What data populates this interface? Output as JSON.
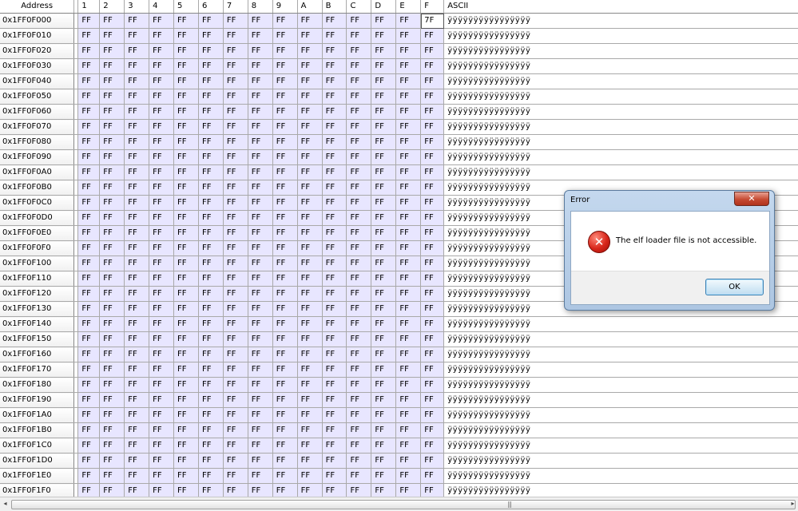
{
  "table": {
    "columns": {
      "address": "Address",
      "hex": [
        "1",
        "2",
        "3",
        "4",
        "5",
        "6",
        "7",
        "8",
        "9",
        "A",
        "B",
        "C",
        "D",
        "E",
        "F"
      ],
      "ascii": "ASCII"
    },
    "rows": [
      {
        "address": "0x1FF0F000",
        "cells": [
          "FF",
          "FF",
          "FF",
          "FF",
          "FF",
          "FF",
          "FF",
          "FF",
          "FF",
          "FF",
          "FF",
          "FF",
          "FF",
          "FF",
          "7F"
        ],
        "ascii": "ÿÿÿÿÿÿÿÿÿÿÿÿÿÿÿÿ"
      },
      {
        "address": "0x1FF0F010",
        "cells": [
          "FF",
          "FF",
          "FF",
          "FF",
          "FF",
          "FF",
          "FF",
          "FF",
          "FF",
          "FF",
          "FF",
          "FF",
          "FF",
          "FF",
          "FF"
        ],
        "ascii": "ÿÿÿÿÿÿÿÿÿÿÿÿÿÿÿÿ"
      },
      {
        "address": "0x1FF0F020",
        "cells": [
          "FF",
          "FF",
          "FF",
          "FF",
          "FF",
          "FF",
          "FF",
          "FF",
          "FF",
          "FF",
          "FF",
          "FF",
          "FF",
          "FF",
          "FF"
        ],
        "ascii": "ÿÿÿÿÿÿÿÿÿÿÿÿÿÿÿÿ"
      },
      {
        "address": "0x1FF0F030",
        "cells": [
          "FF",
          "FF",
          "FF",
          "FF",
          "FF",
          "FF",
          "FF",
          "FF",
          "FF",
          "FF",
          "FF",
          "FF",
          "FF",
          "FF",
          "FF"
        ],
        "ascii": "ÿÿÿÿÿÿÿÿÿÿÿÿÿÿÿÿ"
      },
      {
        "address": "0x1FF0F040",
        "cells": [
          "FF",
          "FF",
          "FF",
          "FF",
          "FF",
          "FF",
          "FF",
          "FF",
          "FF",
          "FF",
          "FF",
          "FF",
          "FF",
          "FF",
          "FF"
        ],
        "ascii": "ÿÿÿÿÿÿÿÿÿÿÿÿÿÿÿÿ"
      },
      {
        "address": "0x1FF0F050",
        "cells": [
          "FF",
          "FF",
          "FF",
          "FF",
          "FF",
          "FF",
          "FF",
          "FF",
          "FF",
          "FF",
          "FF",
          "FF",
          "FF",
          "FF",
          "FF"
        ],
        "ascii": "ÿÿÿÿÿÿÿÿÿÿÿÿÿÿÿÿ"
      },
      {
        "address": "0x1FF0F060",
        "cells": [
          "FF",
          "FF",
          "FF",
          "FF",
          "FF",
          "FF",
          "FF",
          "FF",
          "FF",
          "FF",
          "FF",
          "FF",
          "FF",
          "FF",
          "FF"
        ],
        "ascii": "ÿÿÿÿÿÿÿÿÿÿÿÿÿÿÿÿ"
      },
      {
        "address": "0x1FF0F070",
        "cells": [
          "FF",
          "FF",
          "FF",
          "FF",
          "FF",
          "FF",
          "FF",
          "FF",
          "FF",
          "FF",
          "FF",
          "FF",
          "FF",
          "FF",
          "FF"
        ],
        "ascii": "ÿÿÿÿÿÿÿÿÿÿÿÿÿÿÿÿ"
      },
      {
        "address": "0x1FF0F080",
        "cells": [
          "FF",
          "FF",
          "FF",
          "FF",
          "FF",
          "FF",
          "FF",
          "FF",
          "FF",
          "FF",
          "FF",
          "FF",
          "FF",
          "FF",
          "FF"
        ],
        "ascii": "ÿÿÿÿÿÿÿÿÿÿÿÿÿÿÿÿ"
      },
      {
        "address": "0x1FF0F090",
        "cells": [
          "FF",
          "FF",
          "FF",
          "FF",
          "FF",
          "FF",
          "FF",
          "FF",
          "FF",
          "FF",
          "FF",
          "FF",
          "FF",
          "FF",
          "FF"
        ],
        "ascii": "ÿÿÿÿÿÿÿÿÿÿÿÿÿÿÿÿ"
      },
      {
        "address": "0x1FF0F0A0",
        "cells": [
          "FF",
          "FF",
          "FF",
          "FF",
          "FF",
          "FF",
          "FF",
          "FF",
          "FF",
          "FF",
          "FF",
          "FF",
          "FF",
          "FF",
          "FF"
        ],
        "ascii": "ÿÿÿÿÿÿÿÿÿÿÿÿÿÿÿÿ"
      },
      {
        "address": "0x1FF0F0B0",
        "cells": [
          "FF",
          "FF",
          "FF",
          "FF",
          "FF",
          "FF",
          "FF",
          "FF",
          "FF",
          "FF",
          "FF",
          "FF",
          "FF",
          "FF",
          "FF"
        ],
        "ascii": "ÿÿÿÿÿÿÿÿÿÿÿÿÿÿÿÿ"
      },
      {
        "address": "0x1FF0F0C0",
        "cells": [
          "FF",
          "FF",
          "FF",
          "FF",
          "FF",
          "FF",
          "FF",
          "FF",
          "FF",
          "FF",
          "FF",
          "FF",
          "FF",
          "FF",
          "FF"
        ],
        "ascii": "ÿÿÿÿÿÿÿÿÿÿÿÿÿÿÿÿ"
      },
      {
        "address": "0x1FF0F0D0",
        "cells": [
          "FF",
          "FF",
          "FF",
          "FF",
          "FF",
          "FF",
          "FF",
          "FF",
          "FF",
          "FF",
          "FF",
          "FF",
          "FF",
          "FF",
          "FF"
        ],
        "ascii": "ÿÿÿÿÿÿÿÿÿÿÿÿÿÿÿÿ"
      },
      {
        "address": "0x1FF0F0E0",
        "cells": [
          "FF",
          "FF",
          "FF",
          "FF",
          "FF",
          "FF",
          "FF",
          "FF",
          "FF",
          "FF",
          "FF",
          "FF",
          "FF",
          "FF",
          "FF"
        ],
        "ascii": "ÿÿÿÿÿÿÿÿÿÿÿÿÿÿÿÿ"
      },
      {
        "address": "0x1FF0F0F0",
        "cells": [
          "FF",
          "FF",
          "FF",
          "FF",
          "FF",
          "FF",
          "FF",
          "FF",
          "FF",
          "FF",
          "FF",
          "FF",
          "FF",
          "FF",
          "FF"
        ],
        "ascii": "ÿÿÿÿÿÿÿÿÿÿÿÿÿÿÿÿ"
      },
      {
        "address": "0x1FF0F100",
        "cells": [
          "FF",
          "FF",
          "FF",
          "FF",
          "FF",
          "FF",
          "FF",
          "FF",
          "FF",
          "FF",
          "FF",
          "FF",
          "FF",
          "FF",
          "FF"
        ],
        "ascii": "ÿÿÿÿÿÿÿÿÿÿÿÿÿÿÿÿ"
      },
      {
        "address": "0x1FF0F110",
        "cells": [
          "FF",
          "FF",
          "FF",
          "FF",
          "FF",
          "FF",
          "FF",
          "FF",
          "FF",
          "FF",
          "FF",
          "FF",
          "FF",
          "FF",
          "FF"
        ],
        "ascii": "ÿÿÿÿÿÿÿÿÿÿÿÿÿÿÿÿ"
      },
      {
        "address": "0x1FF0F120",
        "cells": [
          "FF",
          "FF",
          "FF",
          "FF",
          "FF",
          "FF",
          "FF",
          "FF",
          "FF",
          "FF",
          "FF",
          "FF",
          "FF",
          "FF",
          "FF"
        ],
        "ascii": "ÿÿÿÿÿÿÿÿÿÿÿÿÿÿÿÿ"
      },
      {
        "address": "0x1FF0F130",
        "cells": [
          "FF",
          "FF",
          "FF",
          "FF",
          "FF",
          "FF",
          "FF",
          "FF",
          "FF",
          "FF",
          "FF",
          "FF",
          "FF",
          "FF",
          "FF"
        ],
        "ascii": "ÿÿÿÿÿÿÿÿÿÿÿÿÿÿÿÿ"
      },
      {
        "address": "0x1FF0F140",
        "cells": [
          "FF",
          "FF",
          "FF",
          "FF",
          "FF",
          "FF",
          "FF",
          "FF",
          "FF",
          "FF",
          "FF",
          "FF",
          "FF",
          "FF",
          "FF"
        ],
        "ascii": "ÿÿÿÿÿÿÿÿÿÿÿÿÿÿÿÿ"
      },
      {
        "address": "0x1FF0F150",
        "cells": [
          "FF",
          "FF",
          "FF",
          "FF",
          "FF",
          "FF",
          "FF",
          "FF",
          "FF",
          "FF",
          "FF",
          "FF",
          "FF",
          "FF",
          "FF"
        ],
        "ascii": "ÿÿÿÿÿÿÿÿÿÿÿÿÿÿÿÿ"
      },
      {
        "address": "0x1FF0F160",
        "cells": [
          "FF",
          "FF",
          "FF",
          "FF",
          "FF",
          "FF",
          "FF",
          "FF",
          "FF",
          "FF",
          "FF",
          "FF",
          "FF",
          "FF",
          "FF"
        ],
        "ascii": "ÿÿÿÿÿÿÿÿÿÿÿÿÿÿÿÿ"
      },
      {
        "address": "0x1FF0F170",
        "cells": [
          "FF",
          "FF",
          "FF",
          "FF",
          "FF",
          "FF",
          "FF",
          "FF",
          "FF",
          "FF",
          "FF",
          "FF",
          "FF",
          "FF",
          "FF"
        ],
        "ascii": "ÿÿÿÿÿÿÿÿÿÿÿÿÿÿÿÿ"
      },
      {
        "address": "0x1FF0F180",
        "cells": [
          "FF",
          "FF",
          "FF",
          "FF",
          "FF",
          "FF",
          "FF",
          "FF",
          "FF",
          "FF",
          "FF",
          "FF",
          "FF",
          "FF",
          "FF"
        ],
        "ascii": "ÿÿÿÿÿÿÿÿÿÿÿÿÿÿÿÿ"
      },
      {
        "address": "0x1FF0F190",
        "cells": [
          "FF",
          "FF",
          "FF",
          "FF",
          "FF",
          "FF",
          "FF",
          "FF",
          "FF",
          "FF",
          "FF",
          "FF",
          "FF",
          "FF",
          "FF"
        ],
        "ascii": "ÿÿÿÿÿÿÿÿÿÿÿÿÿÿÿÿ"
      },
      {
        "address": "0x1FF0F1A0",
        "cells": [
          "FF",
          "FF",
          "FF",
          "FF",
          "FF",
          "FF",
          "FF",
          "FF",
          "FF",
          "FF",
          "FF",
          "FF",
          "FF",
          "FF",
          "FF"
        ],
        "ascii": "ÿÿÿÿÿÿÿÿÿÿÿÿÿÿÿÿ"
      },
      {
        "address": "0x1FF0F1B0",
        "cells": [
          "FF",
          "FF",
          "FF",
          "FF",
          "FF",
          "FF",
          "FF",
          "FF",
          "FF",
          "FF",
          "FF",
          "FF",
          "FF",
          "FF",
          "FF"
        ],
        "ascii": "ÿÿÿÿÿÿÿÿÿÿÿÿÿÿÿÿ"
      },
      {
        "address": "0x1FF0F1C0",
        "cells": [
          "FF",
          "FF",
          "FF",
          "FF",
          "FF",
          "FF",
          "FF",
          "FF",
          "FF",
          "FF",
          "FF",
          "FF",
          "FF",
          "FF",
          "FF"
        ],
        "ascii": "ÿÿÿÿÿÿÿÿÿÿÿÿÿÿÿÿ"
      },
      {
        "address": "0x1FF0F1D0",
        "cells": [
          "FF",
          "FF",
          "FF",
          "FF",
          "FF",
          "FF",
          "FF",
          "FF",
          "FF",
          "FF",
          "FF",
          "FF",
          "FF",
          "FF",
          "FF"
        ],
        "ascii": "ÿÿÿÿÿÿÿÿÿÿÿÿÿÿÿÿ"
      },
      {
        "address": "0x1FF0F1E0",
        "cells": [
          "FF",
          "FF",
          "FF",
          "FF",
          "FF",
          "FF",
          "FF",
          "FF",
          "FF",
          "FF",
          "FF",
          "FF",
          "FF",
          "FF",
          "FF"
        ],
        "ascii": "ÿÿÿÿÿÿÿÿÿÿÿÿÿÿÿÿ"
      },
      {
        "address": "0x1FF0F1F0",
        "cells": [
          "FF",
          "FF",
          "FF",
          "FF",
          "FF",
          "FF",
          "FF",
          "FF",
          "FF",
          "FF",
          "FF",
          "FF",
          "FF",
          "FF",
          "FF"
        ],
        "ascii": "ÿÿÿÿÿÿÿÿÿÿÿÿÿÿÿÿ"
      }
    ],
    "selected": {
      "row": 0,
      "col": 14
    },
    "colors": {
      "cell_bg": "#e8e6ff",
      "grid_line": "#a9a9a9"
    }
  },
  "dialog": {
    "title": "Error",
    "close_glyph": "✕",
    "icon": "error-icon",
    "icon_glyph": "✕",
    "message": "The elf loader file is not accessible.",
    "ok_label": "OK"
  },
  "scrollbar": {
    "left_arrow": "◂",
    "right_arrow": "▸",
    "grip": "|||"
  }
}
